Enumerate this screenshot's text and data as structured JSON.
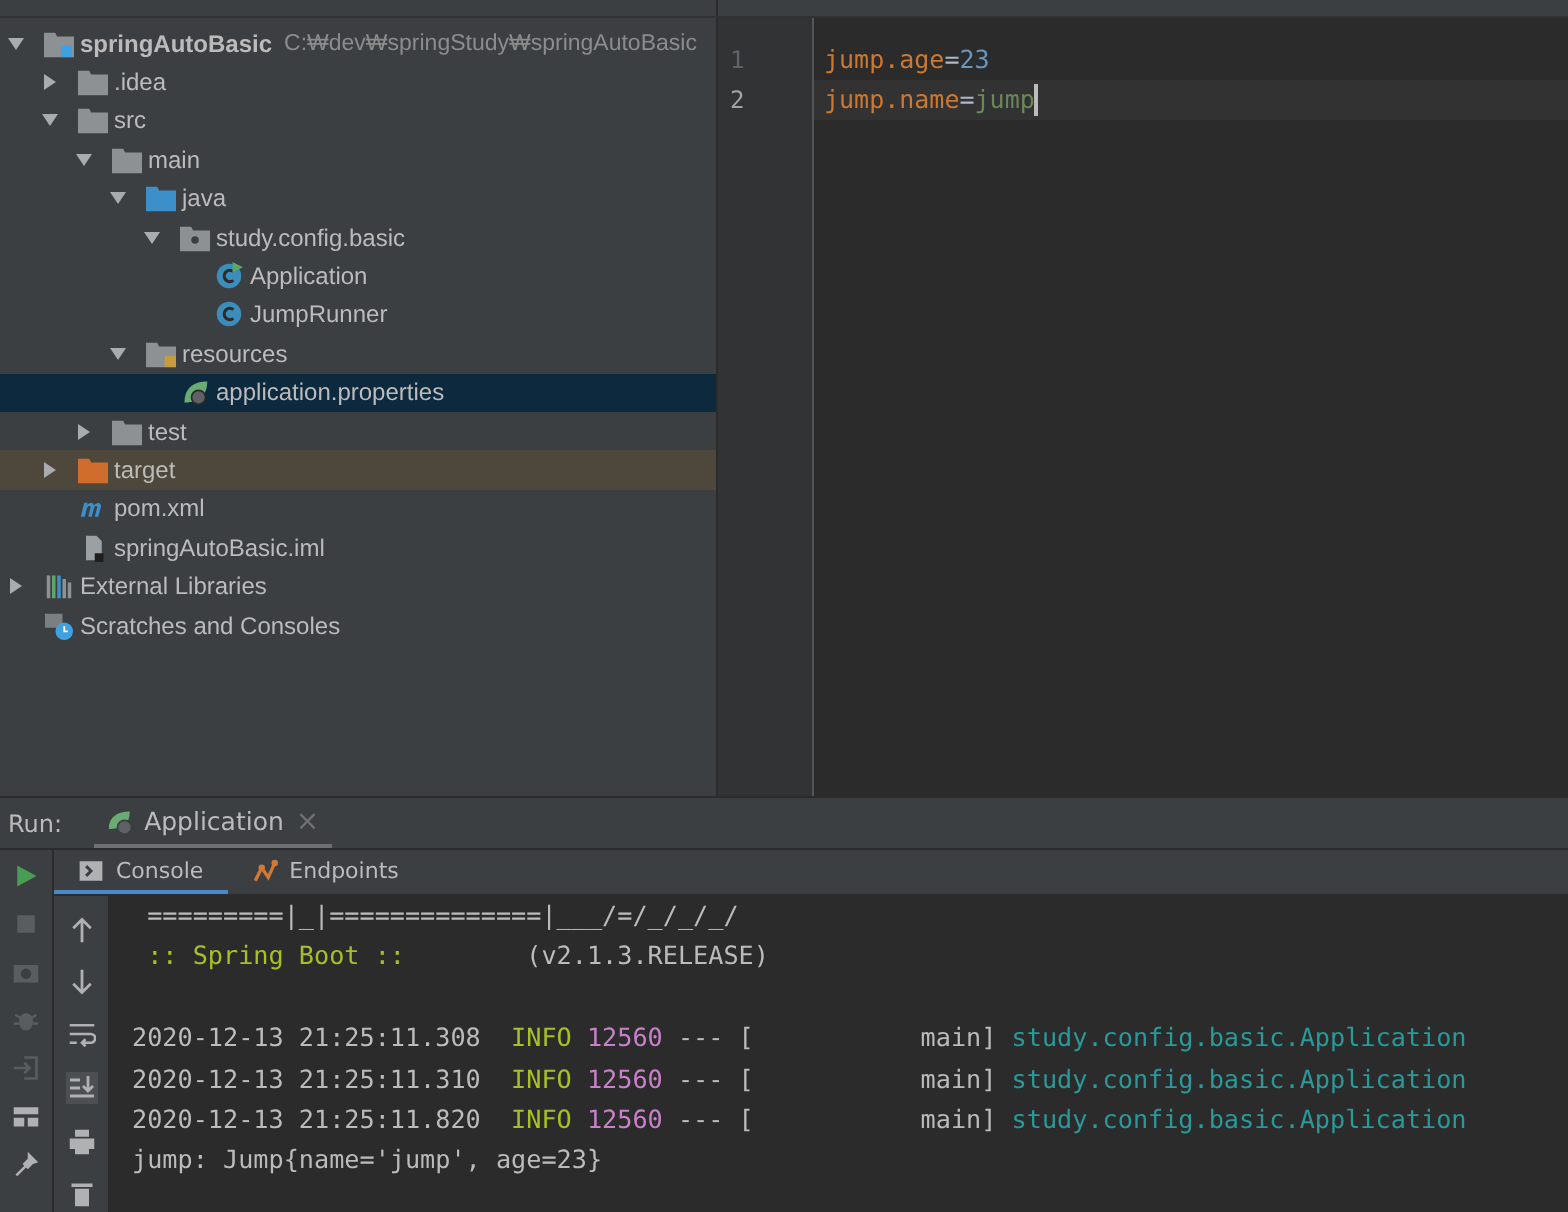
{
  "project_tree": [
    {
      "label": "springAutoBasic",
      "hint": "C:₩dev₩springStudy₩springAutoBasic",
      "kind": "module",
      "expanded": true,
      "selected": false,
      "children": [
        {
          "label": ".idea",
          "kind": "folder",
          "expanded": false,
          "selected": false
        },
        {
          "label": "src",
          "kind": "folder",
          "expanded": true,
          "selected": false,
          "children": [
            {
              "label": "main",
              "kind": "folder",
              "expanded": true,
              "selected": false,
              "children": [
                {
                  "label": "java",
                  "kind": "source-folder",
                  "expanded": true,
                  "selected": false,
                  "children": [
                    {
                      "label": "study.config.basic",
                      "kind": "package",
                      "expanded": true,
                      "selected": false,
                      "children": [
                        {
                          "label": "Application",
                          "kind": "spring-class",
                          "selected": false
                        },
                        {
                          "label": "JumpRunner",
                          "kind": "class",
                          "selected": false
                        }
                      ]
                    }
                  ]
                },
                {
                  "label": "resources",
                  "kind": "resources-folder",
                  "expanded": true,
                  "selected": false,
                  "children": [
                    {
                      "label": "application.properties",
                      "kind": "properties",
                      "selected": true
                    }
                  ]
                }
              ]
            },
            {
              "label": "test",
              "kind": "folder",
              "expanded": false,
              "selected": false
            }
          ]
        },
        {
          "label": "target",
          "kind": "excluded-folder",
          "expanded": false,
          "selected": false
        },
        {
          "label": "pom.xml",
          "kind": "maven",
          "selected": false
        },
        {
          "label": "springAutoBasic.iml",
          "kind": "iml",
          "selected": false
        }
      ]
    },
    {
      "label": "External Libraries",
      "kind": "libraries",
      "expanded": false,
      "selected": false
    },
    {
      "label": "Scratches and Consoles",
      "kind": "scratches",
      "selected": false
    }
  ],
  "editor": {
    "lines": [
      {
        "number": "1",
        "key": "jump.age",
        "sep": "=",
        "value": "23",
        "kind": "number",
        "current": false
      },
      {
        "number": "2",
        "key": "jump.name",
        "sep": "=",
        "value": "jump",
        "kind": "string",
        "current": true
      }
    ]
  },
  "run": {
    "label": "Run:",
    "tab": "Application",
    "close": "×",
    "tabs": [
      {
        "label": "Console",
        "kind": "console",
        "selected": true
      },
      {
        "label": "Endpoints",
        "kind": "endpoints",
        "selected": false
      }
    ],
    "console": [
      {
        "kind": "plain",
        "text": " =========|_|==============|___/=/_/_/_/"
      },
      {
        "kind": "banner",
        "label": " :: Spring Boot :: ",
        "version": "       (v2.1.3.RELEASE)"
      },
      {
        "kind": "blank"
      },
      {
        "kind": "log",
        "time": "2020-12-13 21:25:11.308",
        "level": "  INFO",
        "pid": " 12560",
        "sep": " --- [           main] ",
        "logger": "study.config.basic.Application"
      },
      {
        "kind": "log",
        "time": "2020-12-13 21:25:11.310",
        "level": "  INFO",
        "pid": " 12560",
        "sep": " --- [           main] ",
        "logger": "study.config.basic.Application"
      },
      {
        "kind": "log",
        "time": "2020-12-13 21:25:11.820",
        "level": "  INFO",
        "pid": " 12560",
        "sep": " --- [           main] ",
        "logger": "study.config.basic.Application"
      },
      {
        "kind": "plain",
        "text": "jump: Jump{name='jump', age=23}"
      }
    ]
  }
}
